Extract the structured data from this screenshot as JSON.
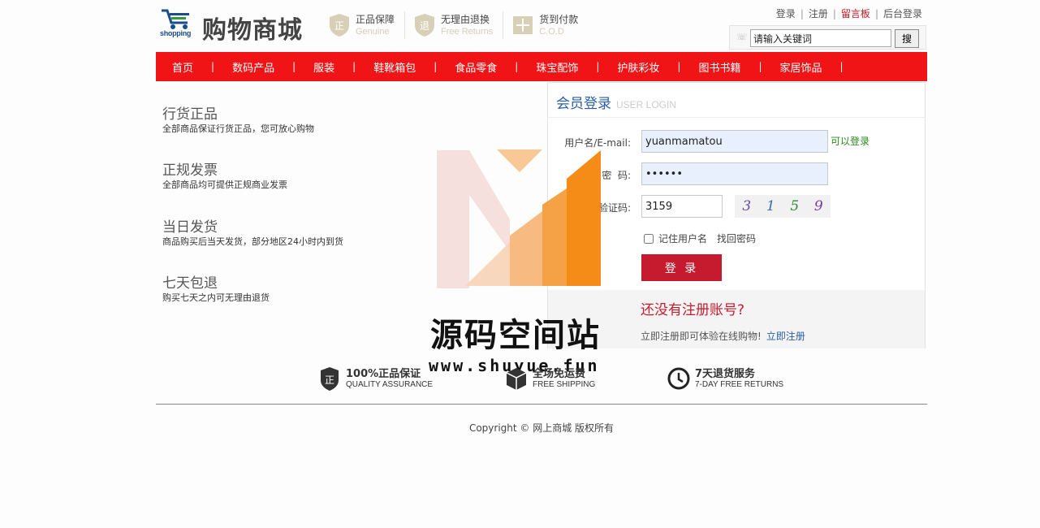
{
  "header": {
    "logo_sub": "shopping",
    "site_title": "购物商城",
    "badges": [
      {
        "title": "正品保障",
        "sub": "Genuine",
        "icon": "shield-genuine-icon"
      },
      {
        "title": "无理由退换",
        "sub": "Free Returns",
        "icon": "shield-return-icon"
      },
      {
        "title": "货到付款",
        "sub": "C.O.D",
        "icon": "cod-icon"
      }
    ],
    "links": {
      "login": "登录",
      "register": "注册",
      "guestbook": "留言板",
      "admin": "后台登录"
    },
    "search": {
      "value": "请输入关键词",
      "button": "搜"
    }
  },
  "nav": {
    "items": [
      "首页",
      "数码产品",
      "服装",
      "鞋靴箱包",
      "食品零食",
      "珠宝配饰",
      "护肤彩妆",
      "图书书籍",
      "家居饰品"
    ]
  },
  "features": [
    {
      "title": "行货正品",
      "desc": "全部商品保证行货正品，您可放心购物"
    },
    {
      "title": "正规发票",
      "desc": "全部商品均可提供正规商业发票"
    },
    {
      "title": "当日发货",
      "desc": "商品购买后当天发货，部分地区24小时内到货"
    },
    {
      "title": "七天包退",
      "desc": "购买七天之内可无理由退货"
    }
  ],
  "login": {
    "title": "会员登录",
    "title_en": "USER LOGIN",
    "username_label": "用户名/E-mail:",
    "username_value": "yuanmamatou",
    "username_status": "可以登录",
    "password_label": "密  码:",
    "password_value": "••••••",
    "captcha_label": "验证码:",
    "captcha_value": "3159",
    "captcha_chars": [
      "3",
      "1",
      "5",
      "9"
    ],
    "remember_label": "记住用户名",
    "forgot_label": "找回密码",
    "submit_label": "登 录",
    "no_account_title": "还没有注册账号?",
    "no_account_text": "立即注册即可体验在线购物!",
    "register_link": "立即注册"
  },
  "watermark": {
    "text": "源码空间站",
    "url": "www.shuyue.fun"
  },
  "services": [
    {
      "title": "100%正品保证",
      "sub": "QUALITY ASSURANCE",
      "icon": "shield-quality-icon"
    },
    {
      "title": "全场免运费",
      "sub": "FREE SHIPPING",
      "icon": "box-icon"
    },
    {
      "title": "7天退货服务",
      "sub": "7-DAY FREE RETURNS",
      "icon": "clock-icon"
    }
  ],
  "footer": {
    "copyright": "Copyright © 网上商城 版权所有"
  },
  "colors": {
    "nav_red": "#f11417",
    "button_red": "#c61b2e",
    "link_blue": "#2a5ea8",
    "ok_green": "#2b8b1c"
  }
}
